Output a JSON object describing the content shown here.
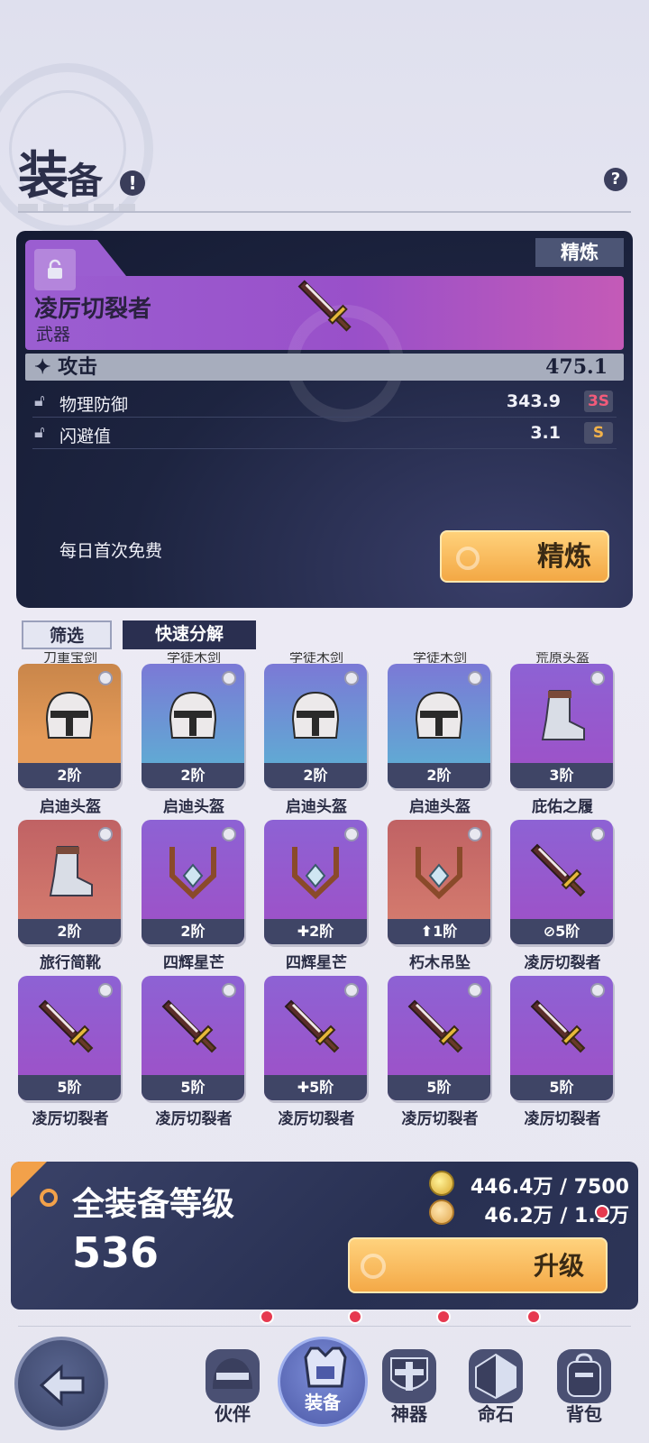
{
  "header": {
    "title_main": "装",
    "title_small": "备",
    "alert_icon": "!",
    "help_icon": "?"
  },
  "detail": {
    "refine_tag": "精炼",
    "item_name": "凌厉切裂者",
    "item_type": "武器",
    "main_stat": {
      "label": "✦ 攻击",
      "value": "475.1"
    },
    "sub_stats": [
      {
        "label": "物理防御",
        "value": "343.9",
        "grade": "3S",
        "grade_color": "#f25b7a"
      },
      {
        "label": "闪避值",
        "value": "3.1",
        "grade": "S",
        "grade_color": "#f2b24a"
      }
    ],
    "free_text": "每日首次免费",
    "refine_button": "精炼"
  },
  "tabs": {
    "filter": "筛选",
    "decompose": "快速分解"
  },
  "cut_row_names": [
    "刀重宝剑",
    "学徒木剑",
    "学徒木剑",
    "学徒木剑",
    "荒原头盔"
  ],
  "items": [
    {
      "icon": "helmet-icon",
      "rarity": "orange",
      "level": "2阶",
      "name": "启迪头盔"
    },
    {
      "icon": "helmet-icon",
      "rarity": "blue",
      "level": "2阶",
      "name": "启迪头盔"
    },
    {
      "icon": "helmet-icon",
      "rarity": "blue",
      "level": "2阶",
      "name": "启迪头盔"
    },
    {
      "icon": "helmet-icon",
      "rarity": "blue",
      "level": "2阶",
      "name": "启迪头盔"
    },
    {
      "icon": "boot-icon",
      "rarity": "purple",
      "level": "3阶",
      "name": "庇佑之履"
    },
    {
      "icon": "boot-icon",
      "rarity": "red",
      "level": "2阶",
      "name": "旅行简靴"
    },
    {
      "icon": "pendant-icon",
      "rarity": "purple",
      "level": "2阶",
      "name": "四辉星芒"
    },
    {
      "icon": "pendant-icon",
      "rarity": "purple",
      "level": "✚2阶",
      "name": "四辉星芒"
    },
    {
      "icon": "pendant-icon",
      "rarity": "red",
      "level": "⬆1阶",
      "name": "朽木吊坠"
    },
    {
      "icon": "sword-icon",
      "rarity": "purple",
      "level": "⊘5阶",
      "name": "凌厉切裂者"
    },
    {
      "icon": "sword-icon",
      "rarity": "purple",
      "level": "5阶",
      "name": "凌厉切裂者"
    },
    {
      "icon": "sword-icon",
      "rarity": "purple",
      "level": "5阶",
      "name": "凌厉切裂者"
    },
    {
      "icon": "sword-icon",
      "rarity": "purple",
      "level": "✚5阶",
      "name": "凌厉切裂者"
    },
    {
      "icon": "sword-icon",
      "rarity": "purple",
      "level": "5阶",
      "name": "凌厉切裂者"
    },
    {
      "icon": "sword-icon",
      "rarity": "purple",
      "level": "5阶",
      "name": "凌厉切裂者"
    }
  ],
  "upgrade": {
    "title": "全装备等级",
    "level": "536",
    "gold_cost": "446.4万 / 7500",
    "coin_cost": "46.2万 / 1.1万",
    "button": "升级"
  },
  "nav": {
    "back": "back-arrow-icon",
    "items": [
      {
        "label": "伙伴",
        "icon": "partner-icon",
        "badge": true
      },
      {
        "label": "装备",
        "icon": "equipment-icon",
        "badge": true,
        "active": true
      },
      {
        "label": "神器",
        "icon": "artifact-icon",
        "badge": true
      },
      {
        "label": "命石",
        "icon": "fate-stone-icon",
        "badge": true
      },
      {
        "label": "背包",
        "icon": "backpack-icon",
        "badge": false
      }
    ]
  }
}
